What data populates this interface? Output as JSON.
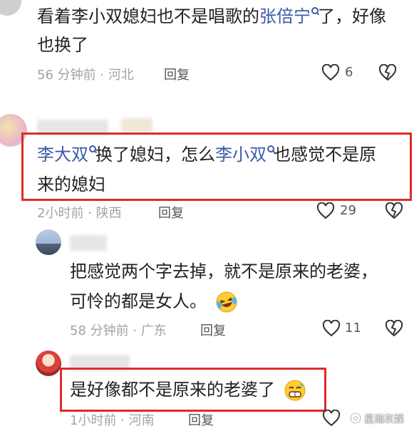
{
  "comment1": {
    "line1_before": "看着李小双媳妇也不是唱歌的",
    "line1_link": "张倍宁",
    "line1_after": "了，好像",
    "line2": "也换了",
    "meta": "56 分钟前 · 河北",
    "reply": "回复",
    "likes": "6"
  },
  "comment2": {
    "link1": "李大双",
    "text1": "换了媳妇，怎么",
    "link2": "李小双",
    "text2": "也感觉不是原",
    "line2": "来的媳妇",
    "meta": "2小时前 · 陕西",
    "reply": "回复",
    "likes": "29"
  },
  "reply1": {
    "line1": "把感觉两个字去掉，就不是原来的老婆，",
    "line2": "可怜的都是女人。",
    "meta": "58 分钟前 · 广东",
    "reply": "回复",
    "likes": "11"
  },
  "reply2": {
    "text": "是好像都不是原来的老婆了",
    "meta": "1小时前 · 河南",
    "reply": "回复"
  },
  "watermark": "星瀚灰娱",
  "colors": {
    "link": "#3a5ba8",
    "highlight_box": "#e02a2a",
    "meta": "#a3a3a3"
  },
  "icons": [
    "heart-outline-icon",
    "broken-heart-icon",
    "search-icon",
    "laughing-crying-emoji",
    "nervous-smile-emoji",
    "watermark-logo-icon"
  ]
}
